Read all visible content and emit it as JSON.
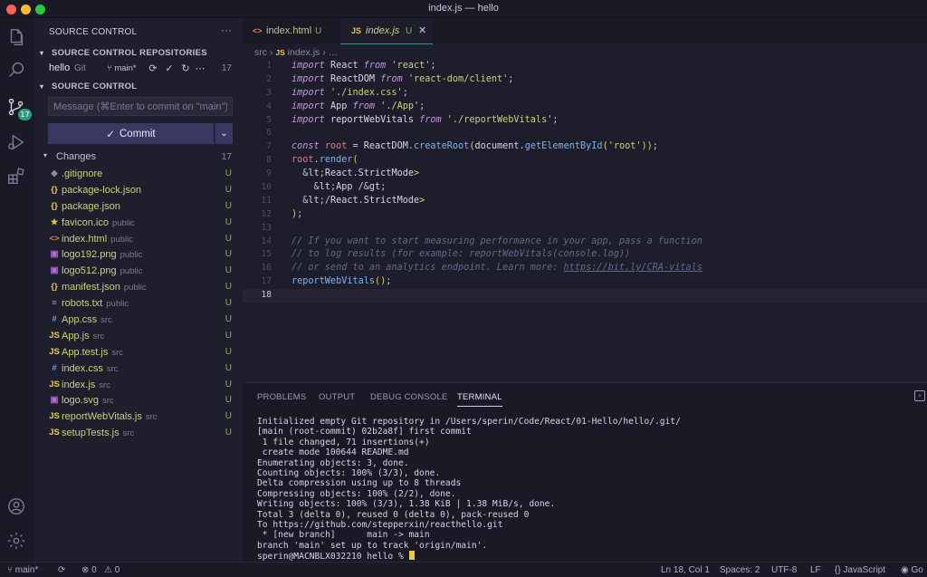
{
  "window": {
    "title": "index.js — hello"
  },
  "activity_bar": {
    "items": [
      "files-icon",
      "search-icon",
      "source-control-icon",
      "run-debug-icon",
      "extensions-icon"
    ],
    "source_control_badge": "17",
    "bottom": [
      "account-icon",
      "settings-gear-icon"
    ]
  },
  "sidebar": {
    "header": "SOURCE CONTROL",
    "more": "···",
    "repositories_title": "SOURCE CONTROL REPOSITORIES",
    "repo": {
      "name": "hello",
      "kind": "Git",
      "branch": "main*",
      "count": "17"
    },
    "sc_title": "SOURCE CONTROL",
    "message_placeholder": "Message (⌘Enter to commit on \"main\")",
    "commit_label": "Commit",
    "changes_label": "Changes",
    "changes_count": "17",
    "files": [
      {
        "icon": "◆",
        "icon_color": "#8c8aa2",
        "name": ".gitignore",
        "dir": "",
        "status": "U"
      },
      {
        "icon": "{}",
        "icon_color": "#e6cc4e",
        "name": "package-lock.json",
        "dir": "",
        "status": "U"
      },
      {
        "icon": "{}",
        "icon_color": "#e6cc4e",
        "name": "package.json",
        "dir": "",
        "status": "U"
      },
      {
        "icon": "★",
        "icon_color": "#e6cc4e",
        "name": "favicon.ico",
        "dir": "public",
        "status": "U"
      },
      {
        "icon": "<>",
        "icon_color": "#e37b4d",
        "name": "index.html",
        "dir": "public",
        "status": "U"
      },
      {
        "icon": "▣",
        "icon_color": "#b46ad6",
        "name": "logo192.png",
        "dir": "public",
        "status": "U"
      },
      {
        "icon": "▣",
        "icon_color": "#b46ad6",
        "name": "logo512.png",
        "dir": "public",
        "status": "U"
      },
      {
        "icon": "{}",
        "icon_color": "#e6cc4e",
        "name": "manifest.json",
        "dir": "public",
        "status": "U"
      },
      {
        "icon": "≡",
        "icon_color": "#8c8aa2",
        "name": "robots.txt",
        "dir": "public",
        "status": "U"
      },
      {
        "icon": "#",
        "icon_color": "#5fa3e0",
        "name": "App.css",
        "dir": "src",
        "status": "U"
      },
      {
        "icon": "JS",
        "icon_color": "#e6cc4e",
        "name": "App.js",
        "dir": "src",
        "status": "U"
      },
      {
        "icon": "JS",
        "icon_color": "#e6cc4e",
        "name": "App.test.js",
        "dir": "src",
        "status": "U"
      },
      {
        "icon": "#",
        "icon_color": "#5fa3e0",
        "name": "index.css",
        "dir": "src",
        "status": "U"
      },
      {
        "icon": "JS",
        "icon_color": "#e6cc4e",
        "name": "index.js",
        "dir": "src",
        "status": "U"
      },
      {
        "icon": "▣",
        "icon_color": "#b46ad6",
        "name": "logo.svg",
        "dir": "src",
        "status": "U"
      },
      {
        "icon": "JS",
        "icon_color": "#e6cc4e",
        "name": "reportWebVitals.js",
        "dir": "src",
        "status": "U"
      },
      {
        "icon": "JS",
        "icon_color": "#e6cc4e",
        "name": "setupTests.js",
        "dir": "src",
        "status": "U"
      }
    ]
  },
  "tabs": [
    {
      "icon": "<>",
      "name": "index.html",
      "status": "U"
    },
    {
      "icon": "JS",
      "name": "index.js",
      "status": "U",
      "close": "✕"
    }
  ],
  "breadcrumb": {
    "folder": "src",
    "sep": "›",
    "icon": "JS",
    "file": "index.js",
    "more": "…"
  },
  "code_lines": [
    "import React from 'react';",
    "import ReactDOM from 'react-dom/client';",
    "import './index.css';",
    "import App from './App';",
    "import reportWebVitals from './reportWebVitals';",
    "",
    "const root = ReactDOM.createRoot(document.getElementById('root'));",
    "root.render(",
    "  <React.StrictMode>",
    "    <App />",
    "  </React.StrictMode>",
    ");",
    "",
    "// If you want to start measuring performance in your app, pass a function",
    "// to log results (for example: reportWebVitals(console.log))",
    "// or send to an analytics endpoint. Learn more: https://bit.ly/CRA-vitals",
    "reportWebVitals();",
    ""
  ],
  "current_line": 18,
  "panel": {
    "tabs": [
      "PROBLEMS",
      "OUTPUT",
      "DEBUG CONSOLE",
      "TERMINAL"
    ],
    "active_tab": "TERMINAL",
    "terminal": [
      "Initialized empty Git repository in /Users/sperin/Code/React/01-Hello/hello/.git/",
      "[main (root-commit) 02b2a8f] first commit",
      " 1 file changed, 71 insertions(+)",
      " create mode 100644 README.md",
      "Enumerating objects: 3, done.",
      "Counting objects: 100% (3/3), done.",
      "Delta compression using up to 8 threads",
      "Compressing objects: 100% (2/2), done.",
      "Writing objects: 100% (3/3), 1.38 KiB | 1.38 MiB/s, done.",
      "Total 3 (delta 0), reused 0 (delta 0), pack-reused 0",
      "To https://github.com/stepperxin/reacthello.git",
      " * [new branch]      main -> main",
      "branch 'main' set up to track 'origin/main'."
    ],
    "prompt": "sperin@MACNBLX032210 hello % "
  },
  "statusbar": {
    "branch": "main*",
    "sync": "⟳",
    "errors": "⊗ 0",
    "warnings": "⚠ 0",
    "position": "Ln 18, Col 1",
    "spaces": "Spaces: 2",
    "encoding": "UTF-8",
    "eol": "LF",
    "language": "{} JavaScript",
    "golive": "Go"
  }
}
